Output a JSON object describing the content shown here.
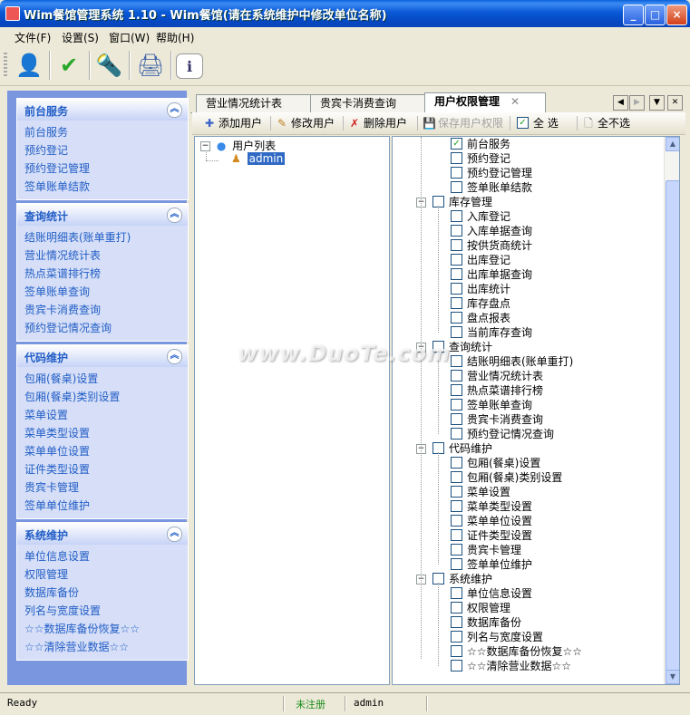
{
  "window": {
    "title": "Wim餐馆管理系统  1.10 - Wim餐馆(请在系统维护中修改单位名称)",
    "min": "_",
    "max": "□",
    "close": "×"
  },
  "menu": [
    {
      "label": "文件(F)"
    },
    {
      "label": "设置(S)"
    },
    {
      "label": "窗口(W)"
    },
    {
      "label": "帮助(H)"
    }
  ],
  "toolbar": {
    "buttons": [
      {
        "icon": "user-icon",
        "glyph": "👤"
      },
      {
        "icon": "checkmark-icon",
        "glyph": "✔"
      },
      {
        "icon": "lamp-icon",
        "glyph": "🔦"
      },
      {
        "icon": "printer-icon",
        "glyph": "🖨"
      },
      {
        "icon": "info-icon",
        "glyph": "ℹ"
      }
    ]
  },
  "sidebar": {
    "panels": [
      {
        "title": "前台服务",
        "items": [
          "前台服务",
          "预约登记",
          "预约登记管理",
          "签单账单结款"
        ]
      },
      {
        "title": "查询统计",
        "items": [
          "结账明细表(账单重打)",
          "营业情况统计表",
          "热点菜谱排行榜",
          "签单账单查询",
          "贵宾卡消费查询",
          "预约登记情况查询"
        ]
      },
      {
        "title": "代码维护",
        "items": [
          "包厢(餐桌)设置",
          "包厢(餐桌)类别设置",
          "菜单设置",
          "菜单类型设置",
          "菜单单位设置",
          "证件类型设置",
          "贵宾卡管理",
          "签单单位维护"
        ]
      },
      {
        "title": "系统维护",
        "items": [
          "单位信息设置",
          "权限管理",
          "数据库备份",
          "列名与宽度设置",
          "☆☆数据库备份恢复☆☆",
          "☆☆清除营业数据☆☆"
        ]
      }
    ]
  },
  "tabs": [
    {
      "label": "营业情况统计表",
      "active": false
    },
    {
      "label": "贵宾卡消费查询",
      "active": false
    },
    {
      "label": "用户权限管理",
      "active": true
    }
  ],
  "subtoolbar": {
    "add_user": "添加用户",
    "edit_user": "修改用户",
    "delete_user": "删除用户",
    "save_perm": "保存用户权限",
    "select_all": "全  选",
    "select_none": "全不选"
  },
  "user_tree": {
    "root": "用户列表",
    "users": [
      "admin"
    ]
  },
  "permissions": {
    "top_items": [
      {
        "label": "前台服务",
        "checked": true
      },
      {
        "label": "预约登记",
        "checked": false
      },
      {
        "label": "预约登记管理",
        "checked": false
      },
      {
        "label": "签单账单结款",
        "checked": false
      }
    ],
    "groups": [
      {
        "label": "库存管理",
        "items": [
          "入库登记",
          "入库单据查询",
          "按供货商统计",
          "出库登记",
          "出库单据查询",
          "出库统计",
          "库存盘点",
          "盘点报表",
          "当前库存查询"
        ]
      },
      {
        "label": "查询统计",
        "items": [
          "结账明细表(账单重打)",
          "营业情况统计表",
          "热点菜谱排行榜",
          "签单账单查询",
          "贵宾卡消费查询",
          "预约登记情况查询"
        ]
      },
      {
        "label": "代码维护",
        "items": [
          "包厢(餐桌)设置",
          "包厢(餐桌)类别设置",
          "菜单设置",
          "菜单类型设置",
          "菜单单位设置",
          "证件类型设置",
          "贵宾卡管理",
          "签单单位维护"
        ]
      },
      {
        "label": "系统维护",
        "items": [
          "单位信息设置",
          "权限管理",
          "数据库备份",
          "列名与宽度设置",
          "☆☆数据库备份恢复☆☆",
          "☆☆清除营业数据☆☆"
        ]
      }
    ]
  },
  "watermark": "www.DuoTe.com",
  "status": {
    "ready": "Ready",
    "registration": "未注册",
    "user": "admin"
  },
  "colors": {
    "titlebar": "#0a5fd8",
    "sidebar_bg": "#7a96df",
    "panel_link": "#215dc6",
    "status_green": "#1b8c1b"
  }
}
